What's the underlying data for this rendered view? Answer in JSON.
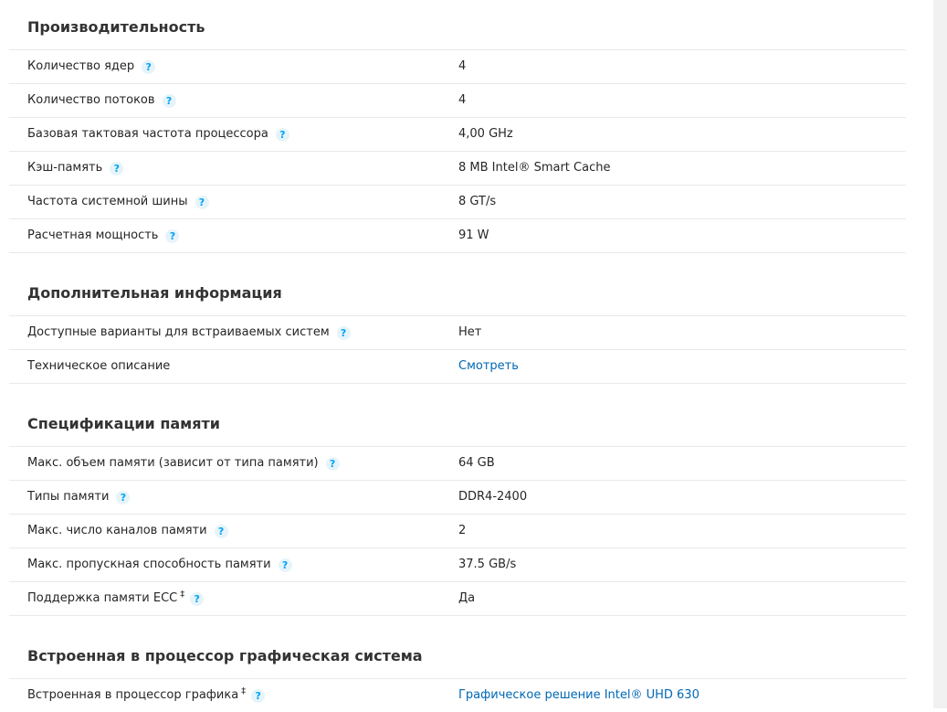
{
  "sections": [
    {
      "title": "Производительность",
      "rows": [
        {
          "label": "Количество ядер",
          "value": "4"
        },
        {
          "label": "Количество потоков",
          "value": "4"
        },
        {
          "label": "Базовая тактовая частота процессора",
          "value": "4,00 GHz"
        },
        {
          "label": "Кэш-память",
          "value": "8 MB Intel® Smart Cache"
        },
        {
          "label": "Частота системной шины",
          "value": "8 GT/s"
        },
        {
          "label": "Расчетная мощность",
          "value": "91 W"
        }
      ]
    },
    {
      "title": "Дополнительная информация",
      "rows": [
        {
          "label": "Доступные варианты для встраиваемых систем",
          "value": "Нет"
        },
        {
          "label": "Техническое описание",
          "value": "Смотреть"
        }
      ]
    },
    {
      "title": "Спецификации памяти",
      "rows": [
        {
          "label": "Макс. объем памяти (зависит от типа памяти)",
          "value": "64 GB"
        },
        {
          "label": "Типы памяти",
          "value": "DDR4-2400"
        },
        {
          "label": "Макс. число каналов памяти",
          "value": "2"
        },
        {
          "label": "Макс. пропускная способность памяти",
          "value": "37.5 GB/s"
        },
        {
          "label": "Поддержка памяти ECC",
          "value": "Да",
          "dagger": "‡"
        }
      ]
    },
    {
      "title": "Встроенная в процессор графическая система",
      "rows": [
        {
          "label": "Встроенная в процессор графика",
          "value": "Графическое решение Intel® UHD 630",
          "dagger": "‡"
        }
      ]
    }
  ],
  "help_icon": "?",
  "colors": {
    "link": "#0068b5",
    "help_icon": "#00a3f6",
    "divider": "#e9e9e9"
  }
}
